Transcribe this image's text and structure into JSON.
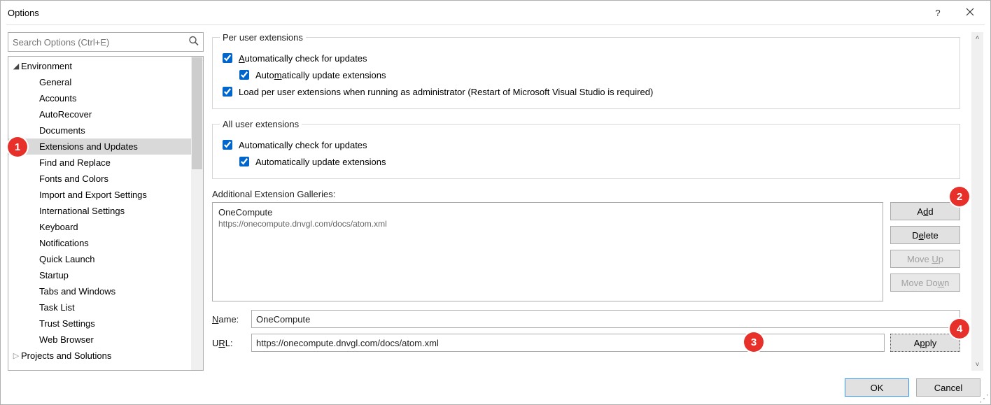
{
  "window": {
    "title": "Options",
    "help_label": "?",
    "close_label": "Close"
  },
  "search": {
    "placeholder": "Search Options (Ctrl+E)"
  },
  "tree": {
    "env": "Environment",
    "items": [
      "General",
      "Accounts",
      "AutoRecover",
      "Documents",
      "Extensions and Updates",
      "Find and Replace",
      "Fonts and Colors",
      "Import and Export Settings",
      "International Settings",
      "Keyboard",
      "Notifications",
      "Quick Launch",
      "Startup",
      "Tabs and Windows",
      "Task List",
      "Trust Settings",
      "Web Browser"
    ],
    "projects": "Projects and Solutions"
  },
  "per_user": {
    "legend": "Per user extensions",
    "auto_check": "Automatically check for updates",
    "auto_update": "Automatically update extensions",
    "load_admin": "Load per user extensions when running as administrator (Restart of Microsoft Visual Studio is required)"
  },
  "all_user": {
    "legend": "All user extensions",
    "auto_check": "Automatically check for updates",
    "auto_update": "Automatically update extensions"
  },
  "galleries": {
    "label": "Additional Extension Galleries:",
    "entry_name": "OneCompute",
    "entry_url": "https://onecompute.dnvgl.com/docs/atom.xml"
  },
  "buttons": {
    "add": "Add",
    "delete": "Delete",
    "move_up": "Move Up",
    "move_down": "Move Down",
    "apply": "Apply",
    "ok": "OK",
    "cancel": "Cancel"
  },
  "form": {
    "name_label": "Name:",
    "name_value": "OneCompute",
    "url_label": "URL:",
    "url_value": "https://onecompute.dnvgl.com/docs/atom.xml"
  },
  "callouts": {
    "c1": "1",
    "c2": "2",
    "c3": "3",
    "c4": "4"
  }
}
